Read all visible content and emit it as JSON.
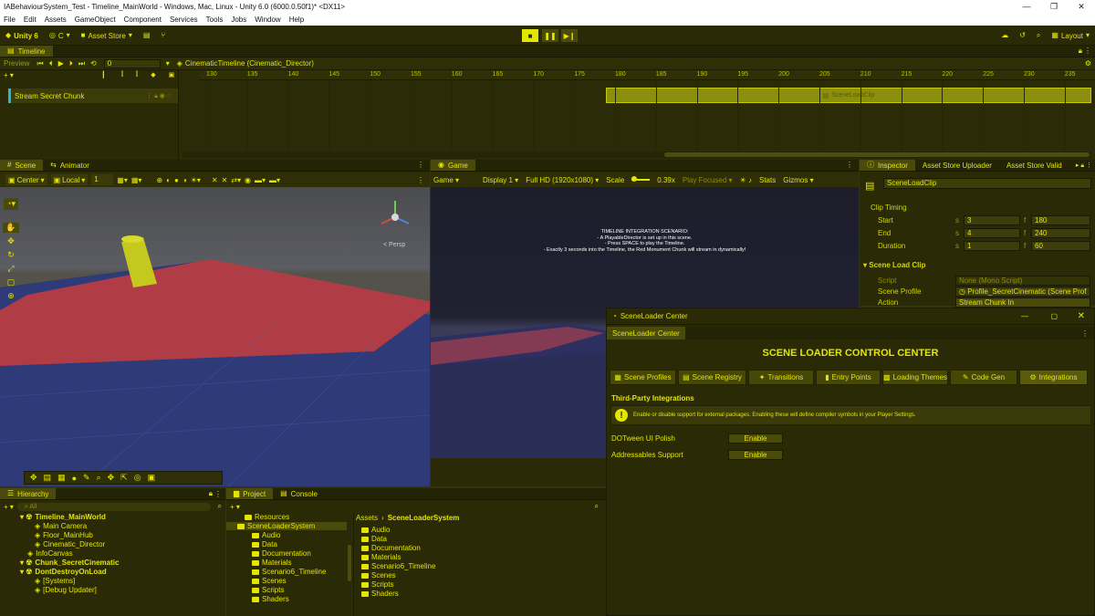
{
  "window": {
    "title": "IABehaviourSystem_Test - Timeline_MainWorld - Windows, Mac, Linux - Unity 6.0 (6000.0.50f1)* <DX11>",
    "controls": [
      "—",
      "❐",
      "✕"
    ]
  },
  "menu": [
    "File",
    "Edit",
    "Assets",
    "GameObject",
    "Component",
    "Services",
    "Tools",
    "Jobs",
    "Window",
    "Help"
  ],
  "toolbar": {
    "unity_label": "Unity 6",
    "account_label": "C",
    "asset_store_label": "Asset Store",
    "layout_label": "Layout"
  },
  "timeline": {
    "tab_label": "Timeline",
    "preview_label": "Preview",
    "frame_value": "0",
    "director_label": "CinematicTimeline (Cinematic_Director)",
    "ruler_ticks": [
      "130",
      "135",
      "140",
      "145",
      "150",
      "155",
      "160",
      "165",
      "170",
      "175",
      "180",
      "185",
      "190",
      "195",
      "200",
      "205",
      "210",
      "215",
      "220",
      "225",
      "230",
      "235"
    ],
    "track_name": "Stream Secret Chunk",
    "clip_name": "SceneLoadClip"
  },
  "scene": {
    "tab_label": "Scene",
    "animator_tab_label": "Animator",
    "pivot_label": "Center",
    "space_label": "Local",
    "grid_value": "1",
    "persp_label": "< Persp"
  },
  "game": {
    "tab_label": "Game",
    "game_dropdown": "Game",
    "display_label": "Display 1",
    "resolution_label": "Full HD (1920x1080)",
    "scale_label": "Scale",
    "scale_value": "0.39x",
    "play_focused_label": "Play Focused",
    "stats_label": "Stats",
    "gizmos_label": "Gizmos",
    "overlay_lines": [
      "TIMELINE INTEGRATION SCENARIO:",
      "- A PlayableDirector is set up in this scene.",
      "- Press SPACE to play the Timeline.",
      "- Exactly 3 seconds into the Timeline, the Red Monument Chunk will stream in dynamically!"
    ]
  },
  "inspector": {
    "tabs": [
      "Inspector",
      "Asset Store Uploader",
      "Asset Store Valid"
    ],
    "object_name": "SceneLoadClip",
    "clip_timing_header": "Clip Timing",
    "rows": [
      {
        "label": "Start",
        "s": "3",
        "f": "180"
      },
      {
        "label": "End",
        "s": "4",
        "f": "240"
      },
      {
        "label": "Duration",
        "s": "1",
        "f": "60"
      }
    ],
    "s_unit": "s",
    "f_unit": "f",
    "scene_load_clip_header": "Scene Load Clip",
    "script_label": "Script",
    "script_value": "None (Mono Script)",
    "scene_profile_label": "Scene Profile",
    "scene_profile_value": "Profile_SecretCinematic (Scene Prof",
    "action_label": "Action",
    "action_value": "Stream Chunk In"
  },
  "hierarchy": {
    "tab_label": "Hierarchy",
    "search_placeholder": "All",
    "items": [
      {
        "label": "Timeline_MainWorld",
        "indent": 0,
        "kind": "scene"
      },
      {
        "label": "Main Camera",
        "indent": 2,
        "kind": "object"
      },
      {
        "label": "Floor_MainHub",
        "indent": 2,
        "kind": "object"
      },
      {
        "label": "Cinematic_Director",
        "indent": 2,
        "kind": "object"
      },
      {
        "label": "InfoCanvas",
        "indent": 1,
        "kind": "object"
      },
      {
        "label": "Chunk_SecretCinematic",
        "indent": 0,
        "kind": "scene"
      },
      {
        "label": "DontDestroyOnLoad",
        "indent": 0,
        "kind": "scene"
      },
      {
        "label": "[Systems]",
        "indent": 2,
        "kind": "object"
      },
      {
        "label": "[Debug Updater]",
        "indent": 2,
        "kind": "object"
      }
    ]
  },
  "project": {
    "tab_label": "Project",
    "console_tab_label": "Console",
    "tree": [
      {
        "label": "Resources",
        "indent": 1
      },
      {
        "label": "SceneLoaderSystem",
        "indent": 0,
        "selected": true
      },
      {
        "label": "Audio",
        "indent": 2
      },
      {
        "label": "Data",
        "indent": 2
      },
      {
        "label": "Documentation",
        "indent": 2
      },
      {
        "label": "Materials",
        "indent": 2
      },
      {
        "label": "Scenario6_Timeline",
        "indent": 2
      },
      {
        "label": "Scenes",
        "indent": 2
      },
      {
        "label": "Scripts",
        "indent": 2
      },
      {
        "label": "Shaders",
        "indent": 2
      }
    ],
    "breadcrumb_root": "Assets",
    "breadcrumb_current": "SceneLoaderSystem",
    "folders": [
      "Audio",
      "Data",
      "Documentation",
      "Materials",
      "Scenario6_Timeline",
      "Scenes",
      "Scripts",
      "Shaders"
    ]
  },
  "scene_loader": {
    "window_title": "SceneLoader Center",
    "tab_label": "SceneLoader Center",
    "heading": "SCENE LOADER CONTROL CENTER",
    "tabs": [
      "Scene Profiles",
      "Scene Registry",
      "Transitions",
      "Entry Points",
      "Loading Themes",
      "Code Gen",
      "Integrations"
    ],
    "section_title": "Third-Party Integrations",
    "info_text": "Enable or disable support for external packages. Enabling these will define compiler symbols in your Player Settings.",
    "integrations": [
      {
        "label": "DOTween UI Polish",
        "button": "Enable"
      },
      {
        "label": "Addressables Support",
        "button": "Enable"
      }
    ]
  },
  "colors": {
    "accent": "#e4e600",
    "panel_bg": "#2a2a07",
    "floor_red": "#b23c45",
    "floor_blue": "#303b78",
    "track_accent": "#2ab3e6"
  }
}
